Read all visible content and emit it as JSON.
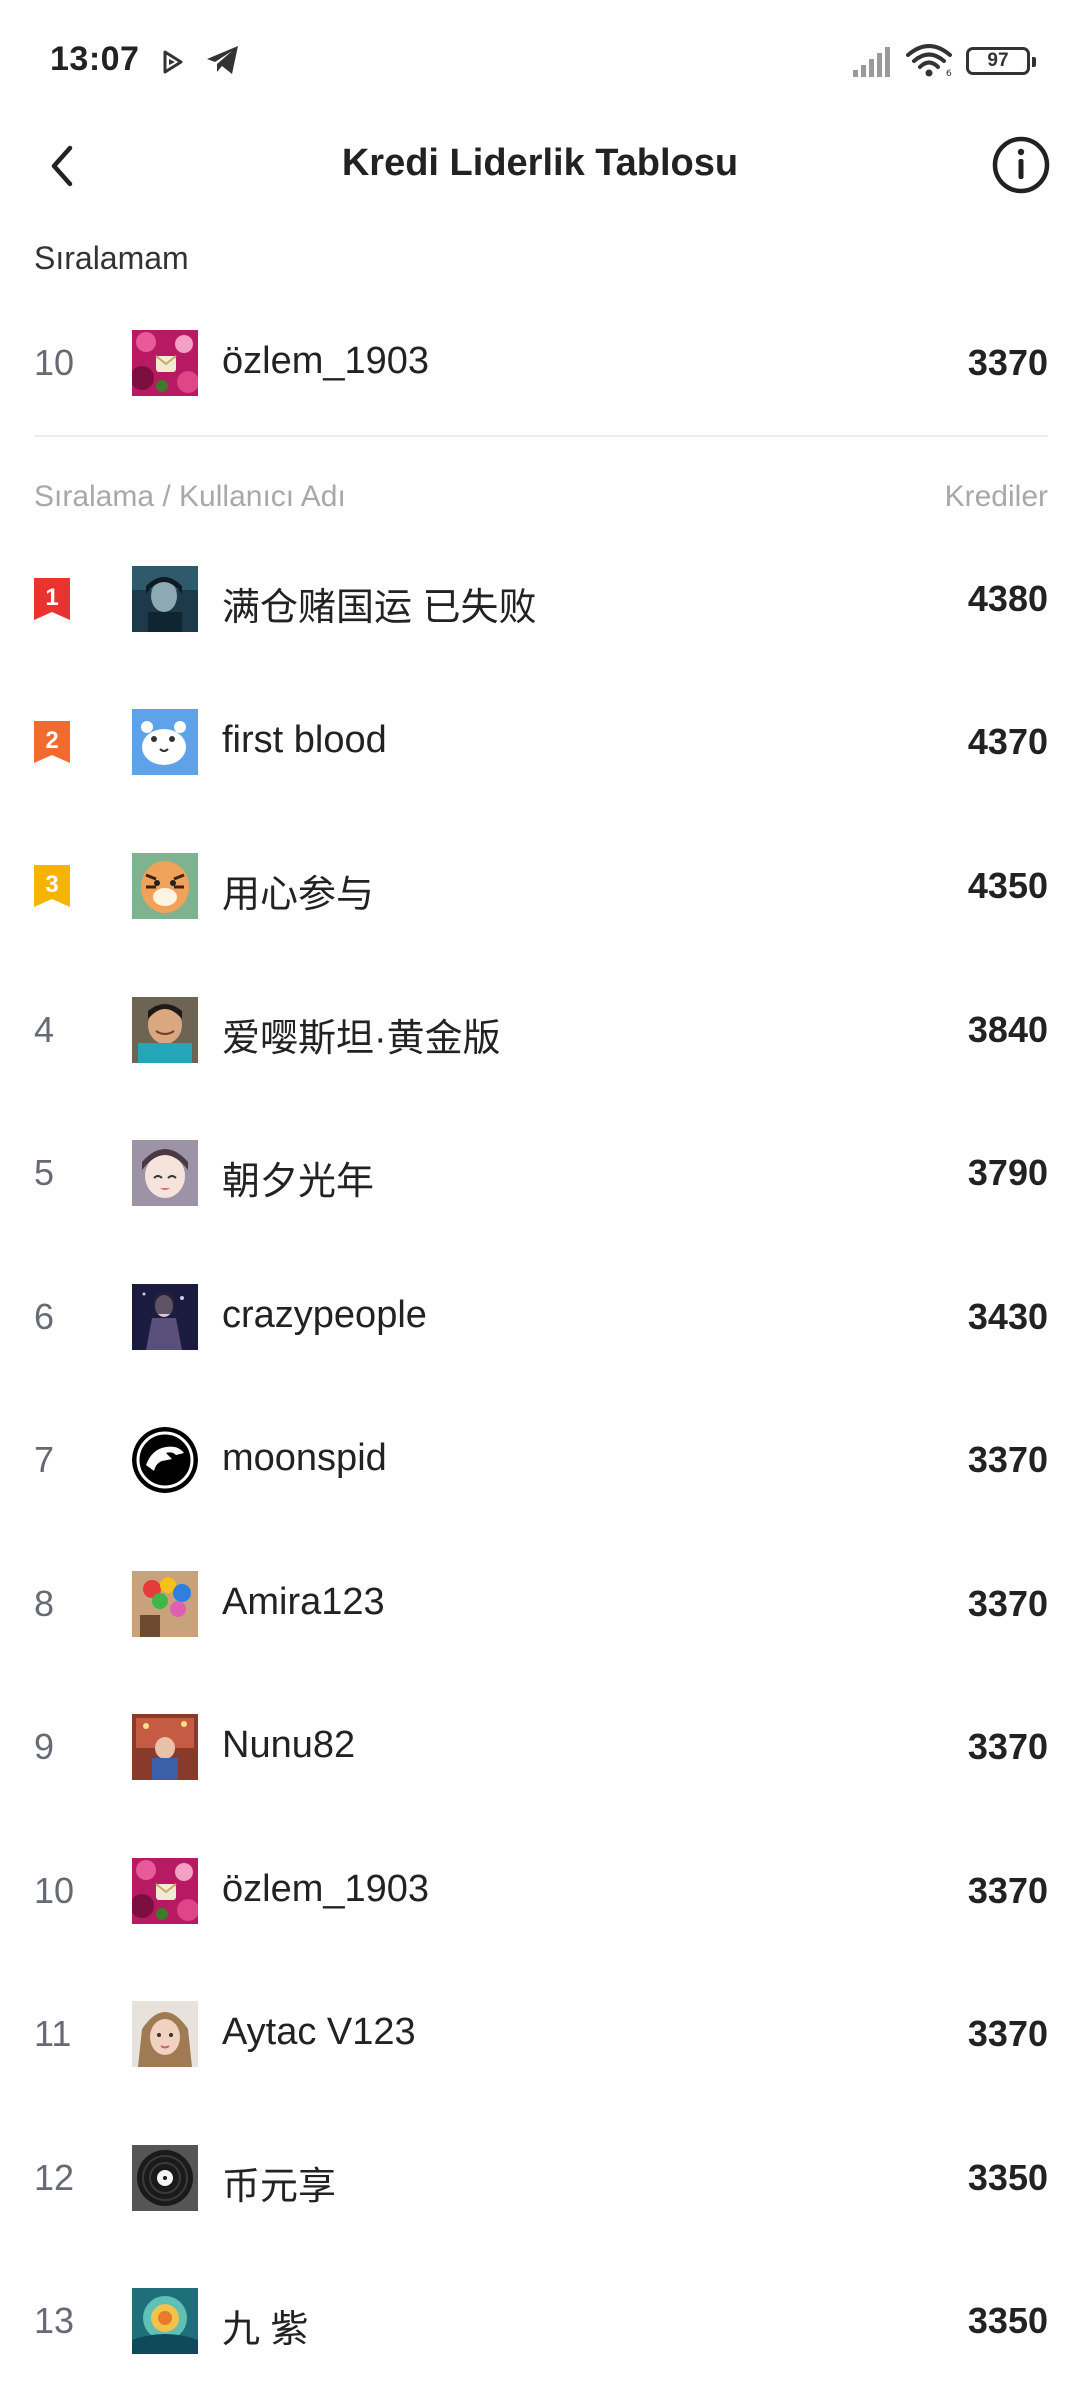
{
  "status_bar": {
    "time": "13:07",
    "battery": "97",
    "icons": [
      "play-icon",
      "telegram-icon",
      "signal-icon",
      "wifi-icon",
      "battery-icon"
    ]
  },
  "header": {
    "title": "Kredi Liderlik Tablosu",
    "back_icon": "chevron-left-icon",
    "info_icon": "info-icon"
  },
  "my_rank": {
    "label": "Sıralamam",
    "rank": "10",
    "username": "özlem_1903",
    "credits": "3370"
  },
  "list_header": {
    "left": "Sıralama / Kullanıcı Adı",
    "right": "Krediler"
  },
  "badge_colors": {
    "1": "#e8332f",
    "2": "#f26a2d",
    "3": "#f5b400"
  },
  "leaderboard": [
    {
      "rank": "1",
      "username": "满仓赌国运 已失败",
      "credits": "4380"
    },
    {
      "rank": "2",
      "username": "first blood",
      "credits": "4370"
    },
    {
      "rank": "3",
      "username": "用心参与",
      "credits": "4350"
    },
    {
      "rank": "4",
      "username": "爱嘤斯坦·黄金版",
      "credits": "3840"
    },
    {
      "rank": "5",
      "username": "朝夕光年",
      "credits": "3790"
    },
    {
      "rank": "6",
      "username": "crazypeople",
      "credits": "3430"
    },
    {
      "rank": "7",
      "username": "moonspid",
      "credits": "3370"
    },
    {
      "rank": "8",
      "username": "Amira123",
      "credits": "3370"
    },
    {
      "rank": "9",
      "username": "Nunu82",
      "credits": "3370"
    },
    {
      "rank": "10",
      "username": "özlem_1903",
      "credits": "3370"
    },
    {
      "rank": "11",
      "username": "Aytac V123",
      "credits": "3370"
    },
    {
      "rank": "12",
      "username": "币元享",
      "credits": "3350"
    },
    {
      "rank": "13",
      "username": "九 紫",
      "credits": "3350"
    }
  ]
}
